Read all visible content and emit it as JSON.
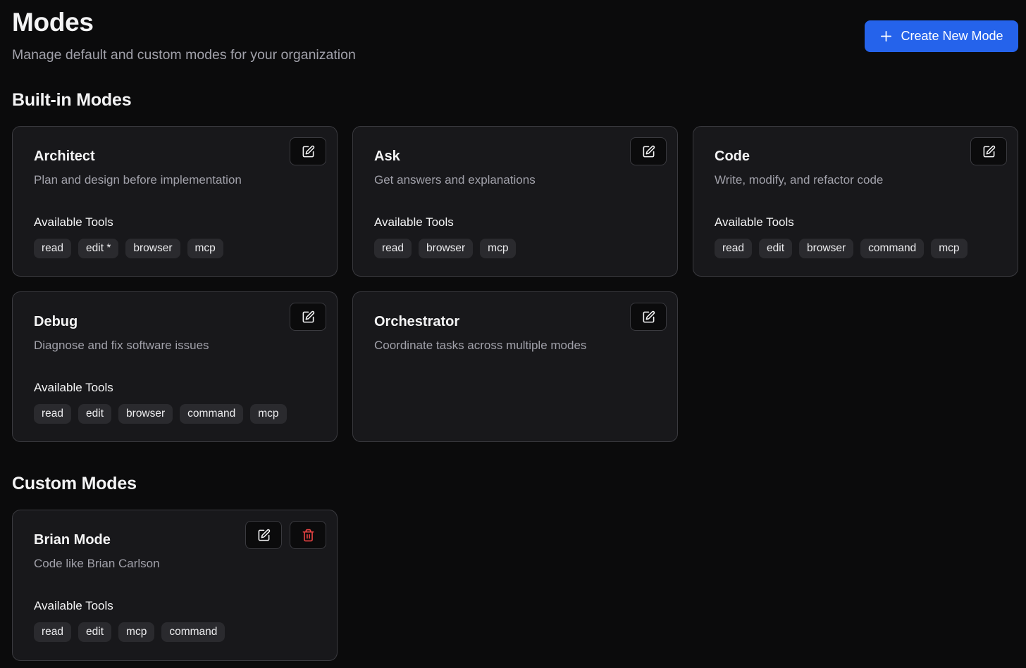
{
  "header": {
    "title": "Modes",
    "subtitle": "Manage default and custom modes for your organization",
    "create_button": "Create New Mode"
  },
  "builtin": {
    "title": "Built-in Modes",
    "cards": [
      {
        "title": "Architect",
        "description": "Plan and design before implementation",
        "tools_label": "Available Tools",
        "tools": [
          "read",
          "edit *",
          "browser",
          "mcp"
        ]
      },
      {
        "title": "Ask",
        "description": "Get answers and explanations",
        "tools_label": "Available Tools",
        "tools": [
          "read",
          "browser",
          "mcp"
        ]
      },
      {
        "title": "Code",
        "description": "Write, modify, and refactor code",
        "tools_label": "Available Tools",
        "tools": [
          "read",
          "edit",
          "browser",
          "command",
          "mcp"
        ]
      },
      {
        "title": "Debug",
        "description": "Diagnose and fix software issues",
        "tools_label": "Available Tools",
        "tools": [
          "read",
          "edit",
          "browser",
          "command",
          "mcp"
        ]
      },
      {
        "title": "Orchestrator",
        "description": "Coordinate tasks across multiple modes",
        "tools_label": "",
        "tools": []
      }
    ]
  },
  "custom": {
    "title": "Custom Modes",
    "cards": [
      {
        "title": "Brian Mode",
        "description": "Code like Brian Carlson",
        "tools_label": "Available Tools",
        "tools": [
          "read",
          "edit",
          "mcp",
          "command"
        ]
      }
    ]
  },
  "icons": {
    "create": "plus-icon",
    "edit": "edit-icon",
    "delete": "trash-icon"
  },
  "colors": {
    "background": "#0b0b0c",
    "card": "#18181b",
    "accent": "#2563eb",
    "danger": "#ef4444"
  }
}
